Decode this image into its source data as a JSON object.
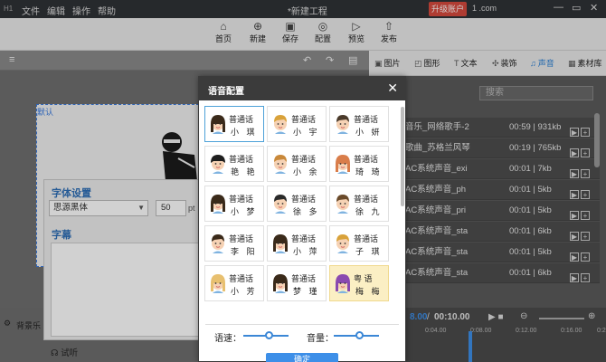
{
  "titlebar": {
    "logo": "H1",
    "menus": [
      "文件",
      "编辑",
      "操作",
      "帮助"
    ],
    "document_title": "*新建工程",
    "upgrade_label": "升级账户",
    "account": "1             .com",
    "window_buttons": [
      "—",
      "▭",
      "✕"
    ]
  },
  "toolbar": {
    "items": [
      {
        "label": "首页",
        "icon": "home-icon",
        "glyph": "⌂"
      },
      {
        "label": "新建",
        "icon": "new-file-icon",
        "glyph": "⊕"
      },
      {
        "label": "保存",
        "icon": "save-icon",
        "glyph": "▣"
      },
      {
        "label": "配置",
        "icon": "gear-icon",
        "glyph": "◎"
      },
      {
        "label": "预览",
        "icon": "preview-icon",
        "glyph": "▷"
      },
      {
        "label": "发布",
        "icon": "publish-icon",
        "glyph": "⇧"
      }
    ]
  },
  "right_tabs": [
    {
      "label": "图片",
      "icon": "image-icon",
      "glyph": "▣",
      "active": false
    },
    {
      "label": "图形",
      "icon": "shape-icon",
      "glyph": "◰",
      "active": false
    },
    {
      "label": "文本",
      "icon": "text-icon",
      "glyph": "T",
      "active": false
    },
    {
      "label": "装饰",
      "icon": "decoration-icon",
      "glyph": "✣",
      "active": false
    },
    {
      "label": "声音",
      "icon": "music-icon",
      "glyph": "♫",
      "active": true
    },
    {
      "label": "素材库",
      "icon": "library-icon",
      "glyph": "▦",
      "active": false
    }
  ],
  "sound_search": {
    "placeholder": "搜索"
  },
  "sound_list": [
    {
      "name": "音乐_网络歌手-2",
      "duration": "00:59 | 931kb"
    },
    {
      "name": "歌曲_苏格兰风琴",
      "duration": "00:19 | 765kb"
    },
    {
      "name": "AC系统声音_exi",
      "duration": "00:01 | 7kb"
    },
    {
      "name": "AC系统声音_ph",
      "duration": "00:01 | 5kb"
    },
    {
      "name": "AC系统声音_pri",
      "duration": "00:01 | 5kb"
    },
    {
      "name": "AC系统声音_sta",
      "duration": "00:01 | 6kb"
    },
    {
      "name": "AC系统声音_sta",
      "duration": "00:01 | 5kb"
    },
    {
      "name": "AC系统声音_sta",
      "duration": "00:01 | 6kb"
    }
  ],
  "canvas": {
    "bracket_label": "默认"
  },
  "font_panel": {
    "heading": "字体设置",
    "font_name": "思源黑体",
    "font_size": "50",
    "unit": "pt",
    "subtitle_heading": "字幕"
  },
  "background_label": "背景乐",
  "try_listen": "试听",
  "timeline": {
    "current": "8.00",
    "total": "00:10.00",
    "ruler": [
      "0:04.00",
      "0:08.00",
      "0:12.00",
      "0:16.00",
      "0:2"
    ]
  },
  "dialog": {
    "title": "语音配置",
    "close": "✕",
    "voices": [
      {
        "type": "普通话",
        "name": "小 琪",
        "selected": true,
        "highlight": false,
        "skin": "#f6d2b4",
        "hair": "#3a2a1a",
        "style": "female"
      },
      {
        "type": "普通话",
        "name": "小 宇",
        "selected": false,
        "highlight": false,
        "skin": "#f6d2b4",
        "hair": "#d9a23a",
        "style": "male"
      },
      {
        "type": "普通话",
        "name": "小 妍",
        "selected": false,
        "highlight": false,
        "skin": "#f6d2b4",
        "hair": "#4a3a2a",
        "style": "male2"
      },
      {
        "type": "普通话",
        "name": "艳 艳",
        "selected": false,
        "highlight": false,
        "skin": "#f6d2b4",
        "hair": "#1f1f1f",
        "style": "dark"
      },
      {
        "type": "普通话",
        "name": "小 余",
        "selected": false,
        "highlight": false,
        "skin": "#f6d2b4",
        "hair": "#c9893a",
        "style": "male"
      },
      {
        "type": "普通话",
        "name": "琦 琦",
        "selected": false,
        "highlight": false,
        "skin": "#f6d2b4",
        "hair": "#d97d4a",
        "style": "female"
      },
      {
        "type": "普通话",
        "name": "小 梦",
        "selected": false,
        "highlight": false,
        "skin": "#f6d2b4",
        "hair": "#3a2a1a",
        "style": "female"
      },
      {
        "type": "普通话",
        "name": "徐 多",
        "selected": false,
        "highlight": false,
        "skin": "#f6d2b4",
        "hair": "#2a2a2a",
        "style": "male2"
      },
      {
        "type": "普通话",
        "name": "徐 九",
        "selected": false,
        "highlight": false,
        "skin": "#f6d2b4",
        "hair": "#6a4a2a",
        "style": "male"
      },
      {
        "type": "普通话",
        "name": "李 阳",
        "selected": false,
        "highlight": false,
        "skin": "#f6d2b4",
        "hair": "#3a2a1a",
        "style": "male2"
      },
      {
        "type": "普通话",
        "name": "小 萍",
        "selected": false,
        "highlight": false,
        "skin": "#f6d2b4",
        "hair": "#3a2a1a",
        "style": "female"
      },
      {
        "type": "普通话",
        "name": "子 琪",
        "selected": false,
        "highlight": false,
        "skin": "#f6d2b4",
        "hair": "#d9a23a",
        "style": "male"
      },
      {
        "type": "普通话",
        "name": "小 芳",
        "selected": false,
        "highlight": false,
        "skin": "#f6d2b4",
        "hair": "#e8c070",
        "style": "female"
      },
      {
        "type": "普通话",
        "name": "梦 瑾",
        "selected": false,
        "highlight": false,
        "skin": "#f6d2b4",
        "hair": "#3a2a1a",
        "style": "female"
      },
      {
        "type": "粤 语",
        "name": "梅 梅",
        "selected": false,
        "highlight": true,
        "skin": "#f6d2b4",
        "hair": "#8a4ab0",
        "style": "female"
      }
    ],
    "speed_label": "语速：",
    "speed_value": 0.55,
    "volume_label": "音量：",
    "volume_value": 0.55,
    "ok_label": "确定"
  },
  "colors": {
    "accent": "#3d8fe8",
    "titlebar": "#2f3236",
    "upgrade": "#d64a3e",
    "highlight_card": "#fbefc4"
  }
}
